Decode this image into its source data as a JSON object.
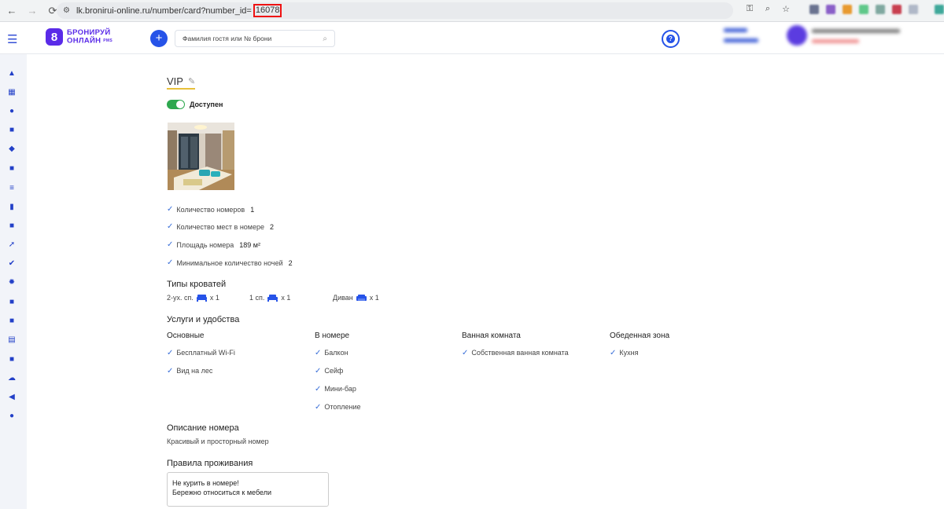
{
  "browser": {
    "url_prefix": "lk.bronirui-online.ru/number/card?number_id=",
    "url_highlight": "16078"
  },
  "header": {
    "logo_line1": "БРОНИРУЙ",
    "logo_line2": "ОНЛАЙН",
    "logo_suffix": "PMS",
    "search_placeholder": "Фамилия гостя или № брони",
    "add_label": "+",
    "help_label": "?"
  },
  "room": {
    "title": "VIP",
    "status_label": "Доступен",
    "status_on": true,
    "properties": [
      {
        "label": "Количество номеров",
        "value": "1"
      },
      {
        "label": "Количество мест в номере",
        "value": "2"
      },
      {
        "label": "Площадь номера",
        "value": "189 м²"
      },
      {
        "label": "Минимальное количество ночей",
        "value": "2"
      }
    ],
    "beds_title": "Типы кроватей",
    "beds": [
      {
        "label": "2-ух. сп.",
        "count": "x  1"
      },
      {
        "label": "1 сп.",
        "count": "x  1"
      },
      {
        "label": "Диван",
        "count": "x  1"
      }
    ],
    "amenities_title": "Услуги и удобства",
    "amenity_groups": [
      {
        "title": "Основные",
        "items": [
          "Бесплатный Wi-Fi",
          "Вид на лес"
        ]
      },
      {
        "title": "В номере",
        "items": [
          "Балкон",
          "Сейф",
          "Мини-бар",
          "Отопление"
        ]
      },
      {
        "title": "Ванная комната",
        "items": [
          "Собственная ванная комната"
        ]
      },
      {
        "title": "Обеденная зона",
        "items": [
          "Кухня"
        ]
      }
    ],
    "description_title": "Описание номера",
    "description": "Красивый и просторный номер",
    "rules_title": "Правила проживания",
    "rules_lines": [
      "Не курить в номере!",
      "Бережно относиться к мебели"
    ]
  },
  "colors": {
    "accent": "#2653e8",
    "brand": "#5a2be8",
    "toggle_on": "#2ea84f",
    "check": "#3a6fd8"
  }
}
